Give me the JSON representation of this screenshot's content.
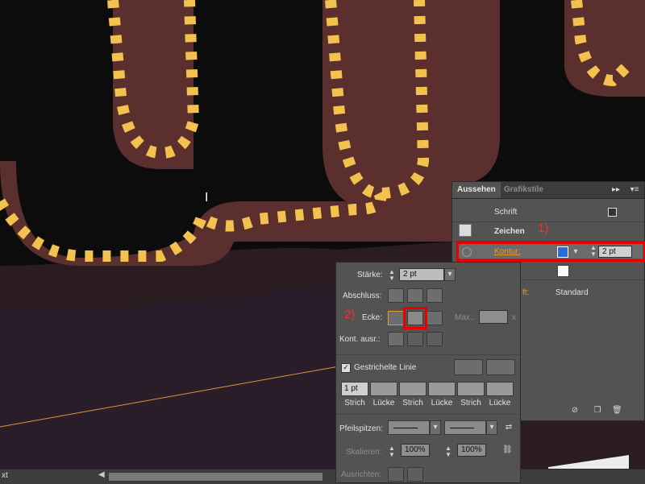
{
  "appearance_panel": {
    "tabs": [
      {
        "label": "Aussehen"
      },
      {
        "label": "Grafikstile"
      }
    ],
    "rows": {
      "schrift": "Schrift",
      "zeichen": "Zeichen",
      "kontur_label": "Kontur:",
      "kontur_value": "2 pt",
      "fl_partial": "ft:",
      "standard": "Standard"
    },
    "icons": {
      "menu": "panel-menu-icon",
      "collapse": "double-chevron-icon",
      "delete": "trash-icon",
      "clear": "no-entry-icon",
      "duplicate": "duplicate-icon"
    }
  },
  "stroke_panel": {
    "staerke_label": "Stärke:",
    "staerke_value": "2 pt",
    "abschluss_label": "Abschluss:",
    "ecke_label": "Ecke:",
    "max_label": "Max.:",
    "max_unit": "x",
    "kont_ausr_label": "Kont. ausr.:",
    "dashed_label": "Gestrichelte Linie",
    "dashed_checked": true,
    "dash_first_value": "1 pt",
    "dash_labels": [
      "Strich",
      "Lücke",
      "Strich",
      "Lücke",
      "Strich",
      "Lücke"
    ],
    "pfeilspitzen_label": "Pfeilspitzen:",
    "skalieren_label": "Skalieren:",
    "skalieren_value_1": "100%",
    "skalieren_value_2": "100%",
    "ausrichten_label": "Ausrichten:"
  },
  "annotations": {
    "num1": "1)",
    "num2": "2)"
  },
  "statusbar": {
    "text": "xt"
  },
  "colors": {
    "accent_red": "#e60000",
    "dash_yellow": "#f2c14e",
    "background_brown": "#4a2c2b"
  }
}
